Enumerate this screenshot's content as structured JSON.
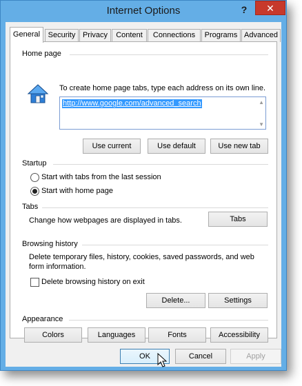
{
  "window": {
    "title": "Internet Options",
    "help_label": "?",
    "close_label": "✕"
  },
  "tabs": [
    {
      "label": "General",
      "active": true
    },
    {
      "label": "Security"
    },
    {
      "label": "Privacy"
    },
    {
      "label": "Content"
    },
    {
      "label": "Connections"
    },
    {
      "label": "Programs"
    },
    {
      "label": "Advanced"
    }
  ],
  "home_page": {
    "heading": "Home page",
    "instruction": "To create home page tabs, type each address on its own line.",
    "url": "http://www.google.com/advanced_search",
    "buttons": {
      "use_current": "Use current",
      "use_default": "Use default",
      "use_new_tab": "Use new tab"
    },
    "icon": "home-page-icon"
  },
  "startup": {
    "heading": "Startup",
    "option_last_session": "Start with tabs from the last session",
    "option_home_page": "Start with home page",
    "selected": "home_page"
  },
  "tabs_section": {
    "heading": "Tabs",
    "description": "Change how webpages are displayed in tabs.",
    "button": "Tabs"
  },
  "browsing_history": {
    "heading": "Browsing history",
    "description_line1": "Delete temporary files, history, cookies, saved passwords, and web",
    "description_line2": "form information.",
    "delete_on_exit": "Delete browsing history on exit",
    "delete_on_exit_checked": false,
    "delete_button": "Delete...",
    "settings_button": "Settings"
  },
  "appearance": {
    "heading": "Appearance",
    "colors": "Colors",
    "languages": "Languages",
    "fonts": "Fonts",
    "accessibility": "Accessibility"
  },
  "footer": {
    "ok": "OK",
    "cancel": "Cancel",
    "apply": "Apply"
  }
}
